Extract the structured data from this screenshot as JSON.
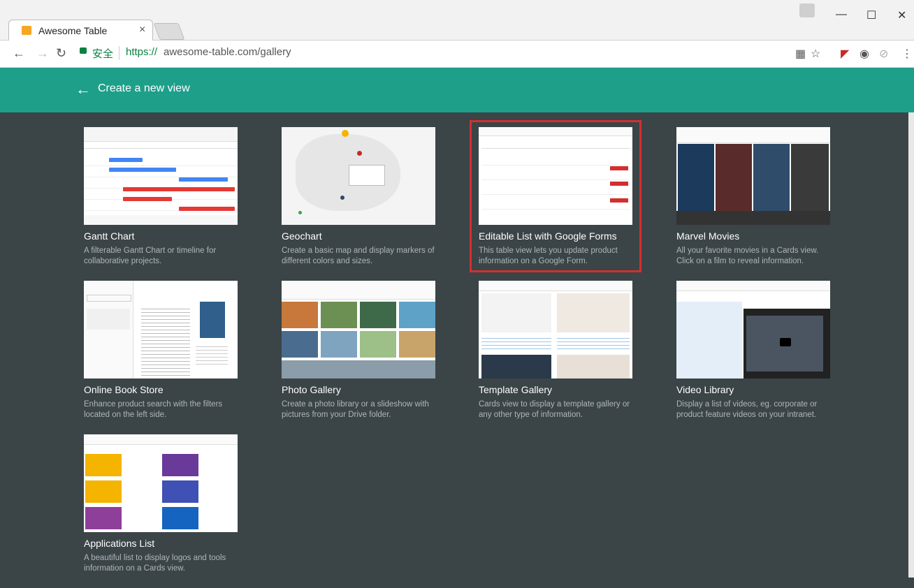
{
  "browser": {
    "tab_title": "Awesome Table",
    "tab_close": "×",
    "secure_label": "安全",
    "url_scheme": "https://",
    "url_rest": "awesome-table.com/gallery",
    "colors": {
      "secure": "#0b8043",
      "appbar": "#1e9f8a",
      "highlight": "#d32f2f",
      "background": "#3b4447"
    }
  },
  "appbar": {
    "back_icon": "←",
    "title": "Create a new view"
  },
  "gallery": [
    {
      "title": "Gantt Chart",
      "desc": "A filterable Gantt Chart or timeline for collaborative projects."
    },
    {
      "title": "Geochart",
      "desc": "Create a basic map and display markers of different colors and sizes."
    },
    {
      "title": "Editable List with Google Forms",
      "desc": "This table view lets you update product information on a Google Form."
    },
    {
      "title": "Marvel Movies",
      "desc": "All your favorite movies in a Cards view. Click on a film to reveal information."
    },
    {
      "title": "Online Book Store",
      "desc": "Enhance product search with the filters located on the left side."
    },
    {
      "title": "Photo Gallery",
      "desc": "Create a photo library or a slideshow with pictures from your Drive folder."
    },
    {
      "title": "Template Gallery",
      "desc": "Cards view to display a template gallery or any other type of information."
    },
    {
      "title": "Video Library",
      "desc": "Display a list of videos, eg. corporate or product feature videos on your intranet."
    },
    {
      "title": "Applications List",
      "desc": "A beautiful list to display logos and tools information on a Cards view."
    }
  ]
}
